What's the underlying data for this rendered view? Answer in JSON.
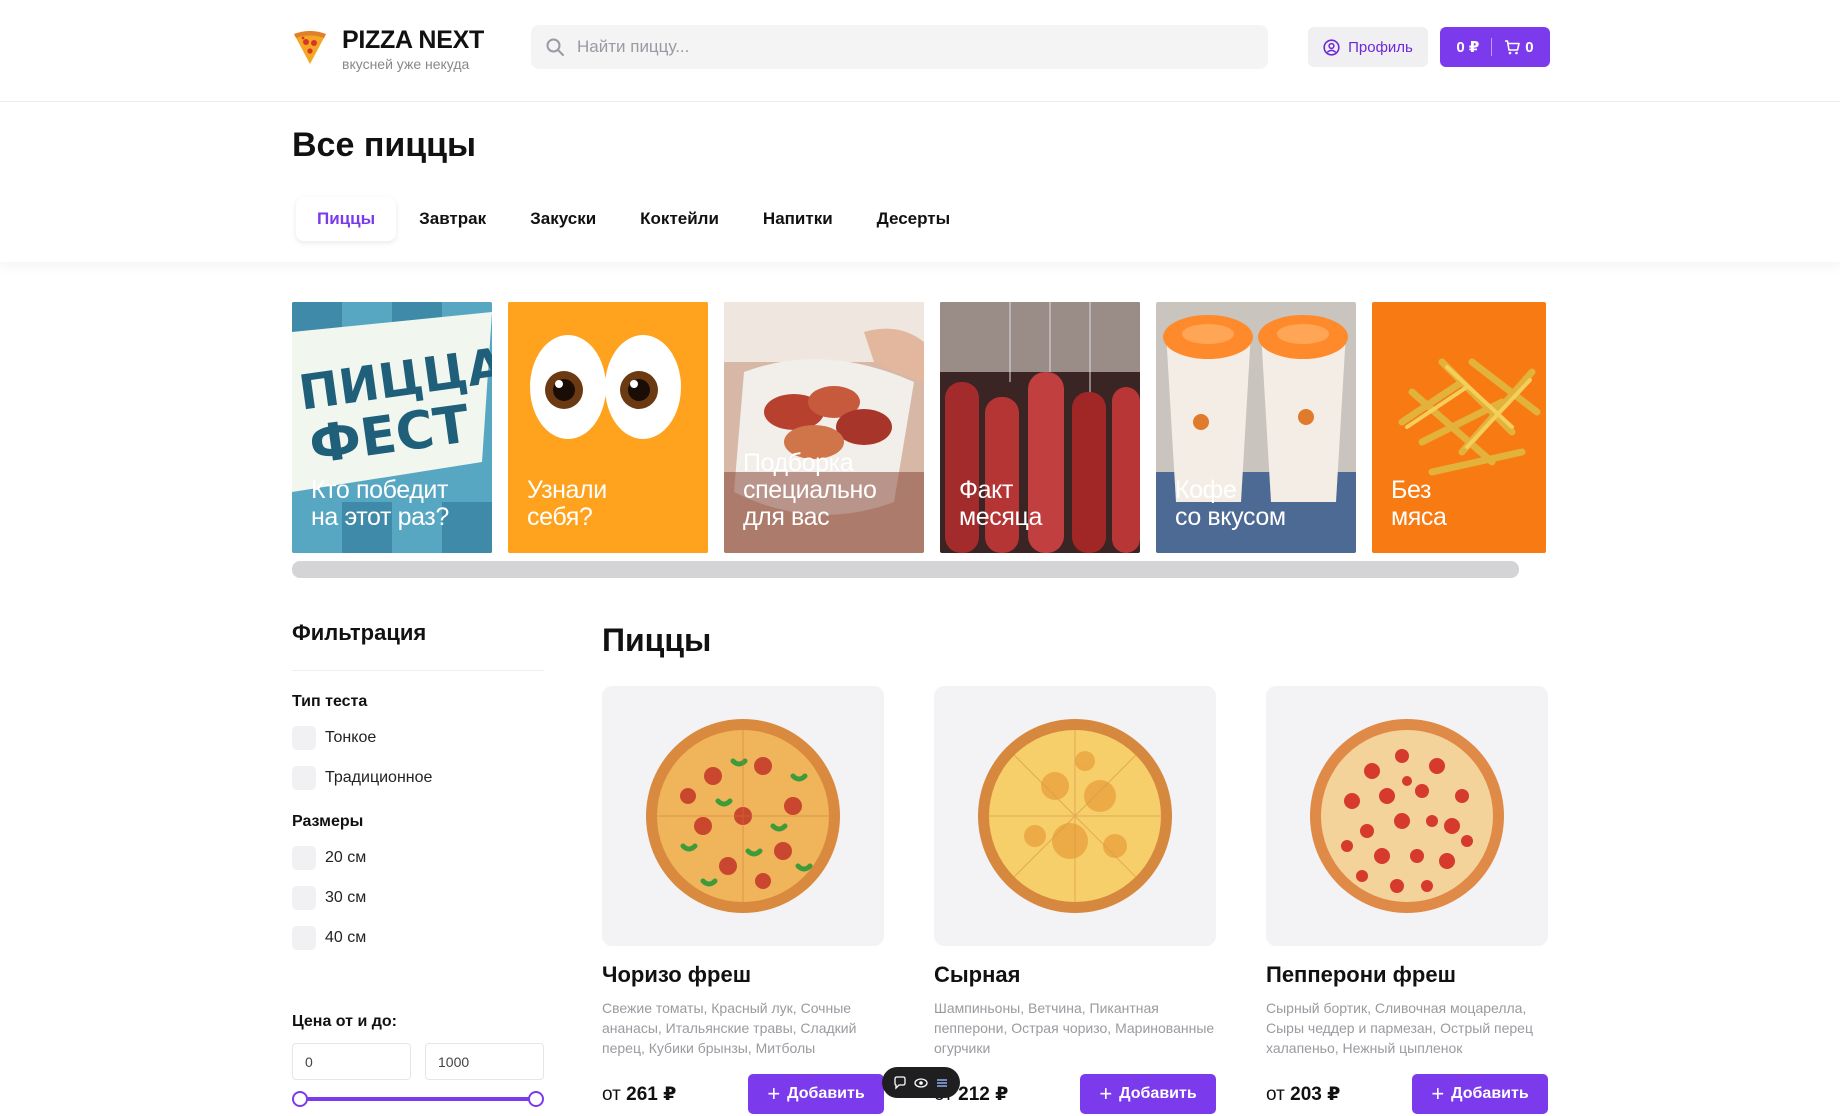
{
  "header": {
    "logo_title": "PIZZA NEXT",
    "logo_subtitle": "вкусней уже некуда",
    "search_placeholder": "Найти пиццу...",
    "profile_label": "Профиль",
    "cart_total": "0 ₽",
    "cart_count": "0",
    "accent_color": "#7c3aed"
  },
  "page_title": "Все пиццы",
  "tabs": [
    "Пиццы",
    "Завтрак",
    "Закуски",
    "Коктейли",
    "Напитки",
    "Десерты"
  ],
  "active_tab": "Пиццы",
  "stories": [
    {
      "text": "Кто победит\nна этот раз?",
      "badge": "ПИЦЦА\nФЕСТ",
      "bg": "#4a9cb8"
    },
    {
      "text": "Узнали\nсебя?",
      "bg": "#ff9d1a"
    },
    {
      "text": "Подборка\nспециально\nдля вас",
      "bg": "#b45d4a"
    },
    {
      "text": "Факт\nмесяца",
      "bg": "#8e2a2a"
    },
    {
      "text": "Кофе\nсо вкусом",
      "bg": "#6d84a6"
    },
    {
      "text": "Без\nмяса",
      "bg": "#f77a12"
    }
  ],
  "filters": {
    "title": "Фильтрация",
    "dough_title": "Тип теста",
    "dough_options": [
      "Тонкое",
      "Традиционное"
    ],
    "sizes_title": "Размеры",
    "size_options": [
      "20 см",
      "30 см",
      "40 см"
    ],
    "price_title": "Цена от и до:",
    "price_from": "0",
    "price_to": "1000"
  },
  "products_title": "Пиццы",
  "products": [
    {
      "name": "Чоризо фреш",
      "desc": "Свежие томаты, Красный лук, Сочные ананасы, Итальянские травы, Сладкий перец, Кубики брынзы, Митболы",
      "price_prefix": "от",
      "price": "261 ₽",
      "button": "Добавить"
    },
    {
      "name": "Сырная",
      "desc": "Шампиньоны, Ветчина, Пикантная пепперони, Острая чоризо, Маринованные огурчики",
      "price_prefix": "от",
      "price": "212 ₽",
      "button": "Добавить"
    },
    {
      "name": "Пепперони фреш",
      "desc": "Сырный бортик, Сливочная моцарелла, Сыры чеддер и пармезан, Острый перец халапеньо, Нежный цыпленок",
      "price_prefix": "от",
      "price": "203 ₽",
      "button": "Добавить"
    }
  ]
}
